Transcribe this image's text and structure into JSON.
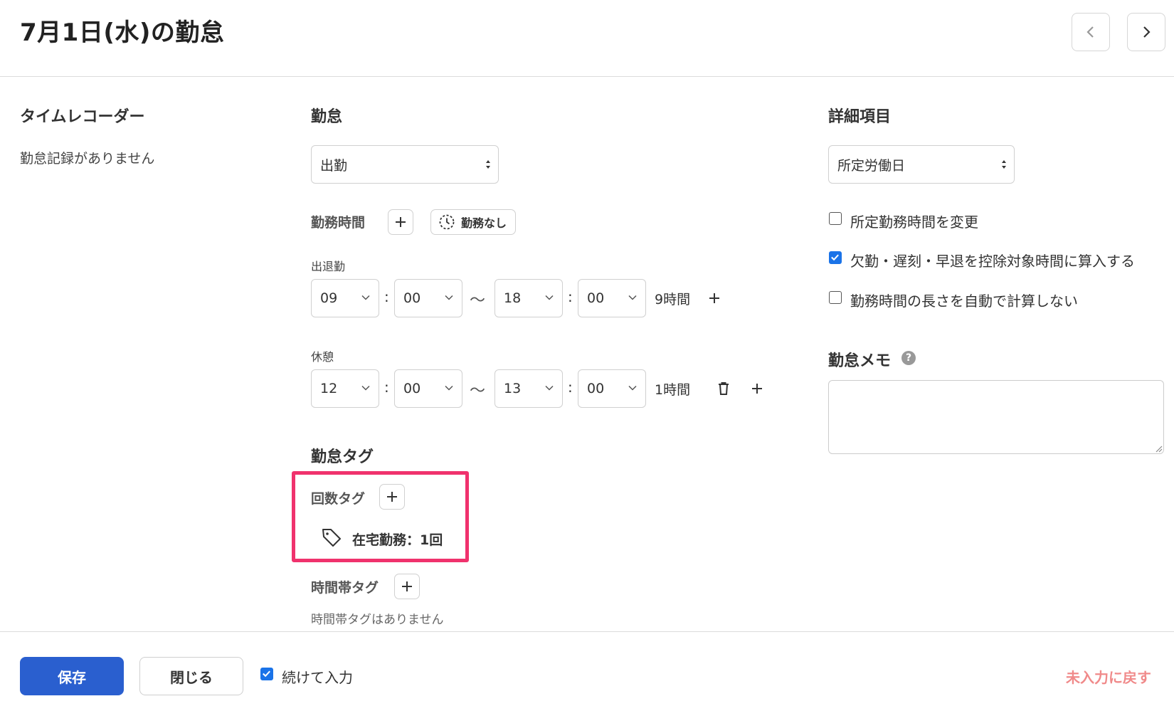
{
  "header": {
    "title": "7月1日(水)の勤怠"
  },
  "timerecorder": {
    "heading": "タイムレコーダー",
    "empty_text": "勤怠記録がありません"
  },
  "attendance": {
    "heading": "勤怠",
    "type_value": "出勤",
    "work_time_label": "勤務時間",
    "no_work_label": "勤務なし",
    "shift": {
      "label": "出退勤",
      "start_hour": "09",
      "start_min": "00",
      "end_hour": "18",
      "end_min": "00",
      "duration": "9時間"
    },
    "break": {
      "label": "休憩",
      "start_hour": "12",
      "start_min": "00",
      "end_hour": "13",
      "end_min": "00",
      "duration": "1時間"
    },
    "colon": ":",
    "tilde": "～"
  },
  "tags": {
    "heading": "勤怠タグ",
    "count_tag_label": "回数タグ",
    "count_tag_item": "在宅勤務：1回",
    "timezone_tag_label": "時間帯タグ",
    "timezone_tag_empty": "時間帯タグはありません"
  },
  "details": {
    "heading": "詳細項目",
    "day_type_value": "所定労働日",
    "options": [
      {
        "label": "所定勤務時間を変更",
        "checked": false
      },
      {
        "label": "欠勤・遅刻・早退を控除対象時間に算入する",
        "checked": true
      },
      {
        "label": "勤務時間の長さを自動で計算しない",
        "checked": false
      }
    ],
    "memo_heading": "勤怠メモ",
    "memo_value": ""
  },
  "footer": {
    "save_label": "保存",
    "close_label": "閉じる",
    "continue_label": "続けて入力",
    "continue_checked": true,
    "reset_label": "未入力に戻す"
  },
  "colors": {
    "primary": "#2a5fcf",
    "highlight": "#f0326d",
    "checkbox_on": "#1a73e8",
    "reset_link": "#f08a8a"
  }
}
